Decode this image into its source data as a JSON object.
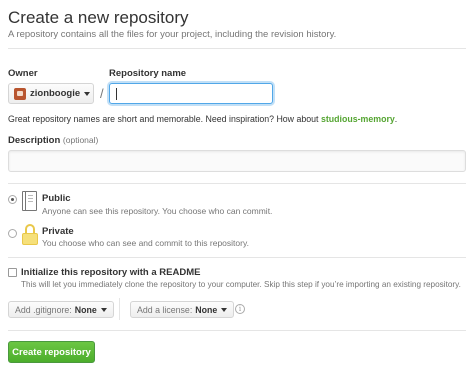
{
  "header": {
    "title": "Create a new repository",
    "subtitle": "A repository contains all the files for your project, including the revision history."
  },
  "owner": {
    "label": "Owner",
    "value": "zionboogie"
  },
  "repo_name": {
    "label": "Repository name",
    "value": ""
  },
  "separator": "/",
  "hint": {
    "prefix": "Great repository names are short and memorable. Need inspiration? How about ",
    "suggestion": "studious-memory",
    "suffix": "."
  },
  "description": {
    "label": "Description",
    "optional": "(optional)",
    "value": ""
  },
  "visibility": {
    "public": {
      "title": "Public",
      "desc": "Anyone can see this repository. You choose who can commit.",
      "selected": true
    },
    "private": {
      "title": "Private",
      "desc": "You choose who can see and commit to this repository.",
      "selected": false
    }
  },
  "init": {
    "title": "Initialize this repository with a README",
    "desc": "This will let you immediately clone the repository to your computer. Skip this step if you’re importing an existing repository.",
    "checked": false
  },
  "gitignore": {
    "prefix": "Add .gitignore:",
    "value": "None"
  },
  "license": {
    "prefix": "Add a license:",
    "value": "None"
  },
  "info_glyph": "i",
  "create_button": "Create repository",
  "colors": {
    "create_green": "#55a532",
    "suggestion_green": "#55a532",
    "focus_blue": "#51a7e8"
  }
}
